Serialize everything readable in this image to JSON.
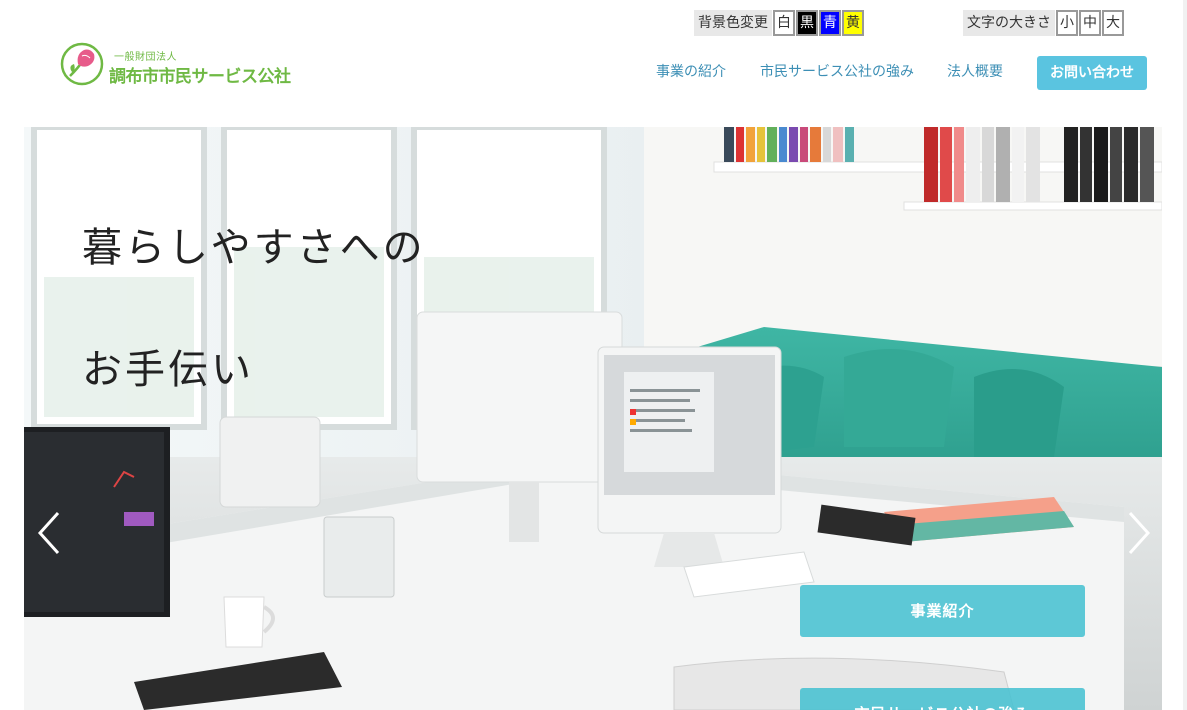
{
  "background_controls": {
    "label": "背景色変更",
    "options": [
      {
        "label": "白",
        "color": "#ffffff"
      },
      {
        "label": "黒",
        "color": "#000000"
      },
      {
        "label": "青",
        "color": "#0000ff"
      },
      {
        "label": "黄",
        "color": "#ffff00"
      }
    ]
  },
  "font_size_controls": {
    "label": "文字の大きさ",
    "options": [
      "小",
      "中",
      "大"
    ]
  },
  "logo": {
    "small_text": "一般財団法人",
    "name": "調布市市民サービス公社",
    "icon": "carnation-flower-icon",
    "color": "#6fb944"
  },
  "nav": {
    "items": [
      "事業の紹介",
      "市民サービス公社の強み",
      "法人概要"
    ],
    "contact_label": "お問い合わせ",
    "link_color": "#3d8fb5",
    "contact_color": "#5ac4e0"
  },
  "hero": {
    "line1": "暮らしやすさへの",
    "line2": "お手伝い",
    "prev_icon": "chevron-left-icon",
    "next_icon": "chevron-right-icon",
    "cta_buttons": [
      "事業紹介",
      "市民サービス公社の強み"
    ],
    "cta_color": "#48c2d2"
  }
}
